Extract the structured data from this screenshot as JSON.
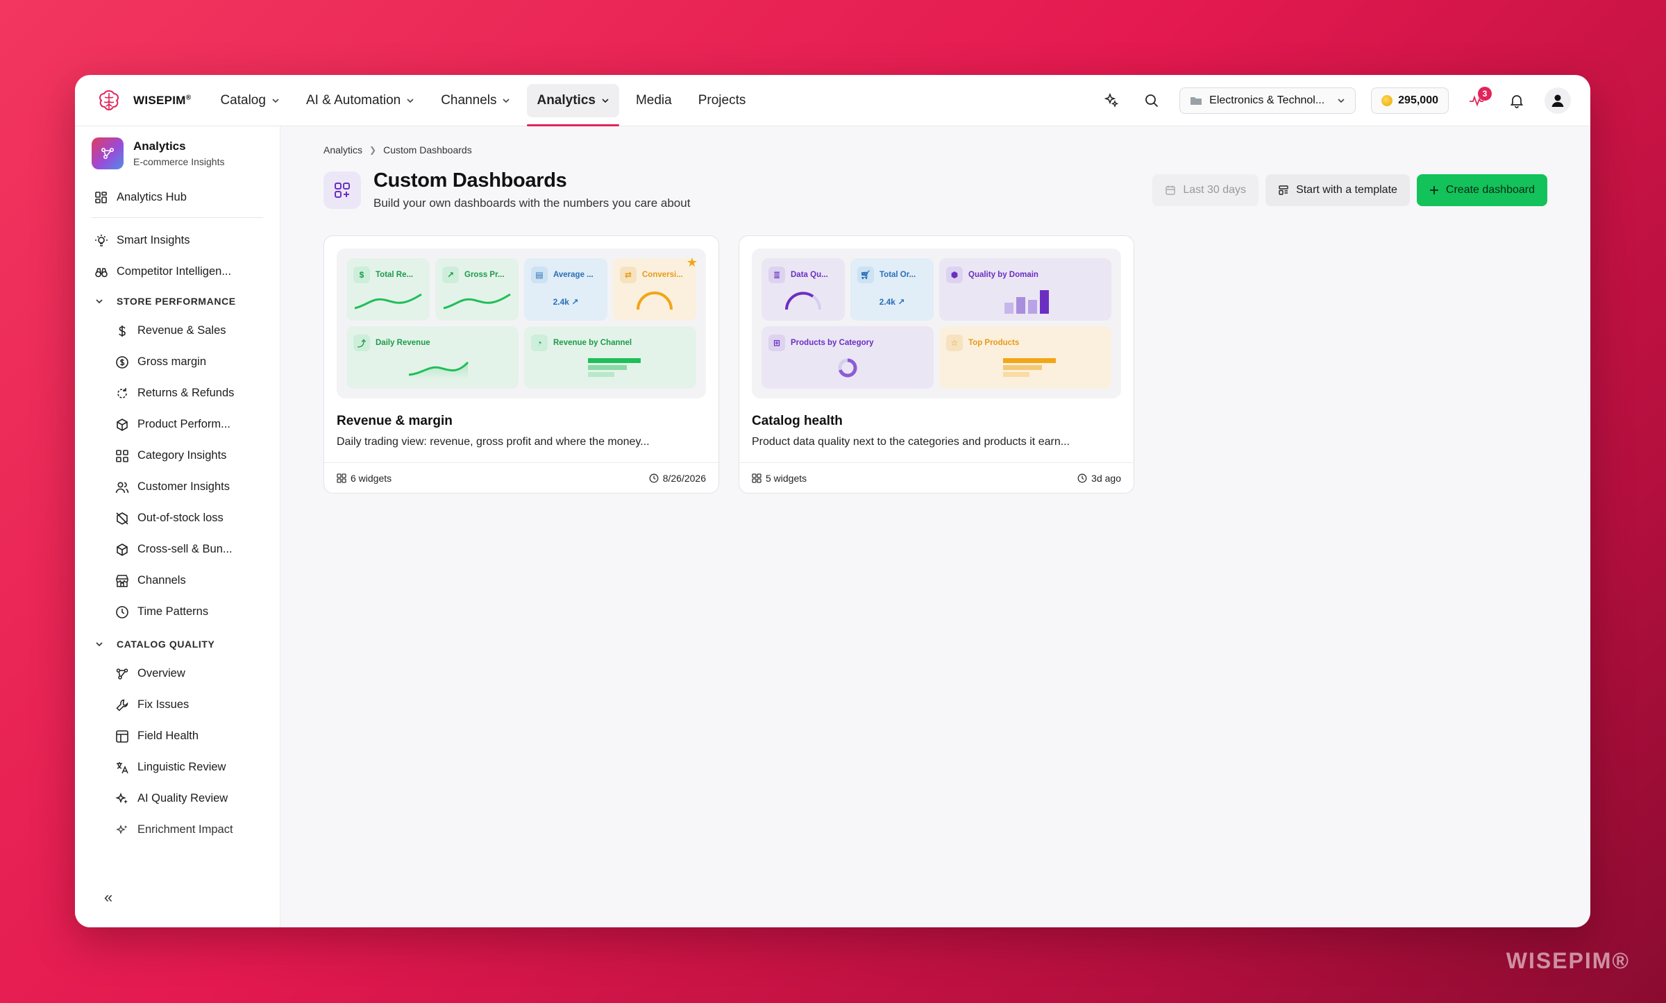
{
  "brand": {
    "name": "WISEPIM",
    "mark": "®"
  },
  "nav": {
    "items": [
      {
        "label": "Catalog",
        "dropdown": true
      },
      {
        "label": "AI & Automation",
        "dropdown": true
      },
      {
        "label": "Channels",
        "dropdown": true
      },
      {
        "label": "Analytics",
        "dropdown": true,
        "active": true
      },
      {
        "label": "Media",
        "dropdown": false
      },
      {
        "label": "Projects",
        "dropdown": false
      }
    ],
    "workspace": "Electronics & Technol...",
    "credits": "295,000",
    "activity_badge": "3"
  },
  "sidebar": {
    "title": "Analytics",
    "subtitle": "E-commerce Insights",
    "hub": "Analytics Hub",
    "top_items": [
      "Smart Insights",
      "Competitor Intelligen..."
    ],
    "sections": [
      {
        "label": "STORE PERFORMANCE",
        "items": [
          "Revenue & Sales",
          "Gross margin",
          "Returns & Refunds",
          "Product Perform...",
          "Category Insights",
          "Customer Insights",
          "Out-of-stock loss",
          "Cross-sell & Bun...",
          "Channels",
          "Time Patterns"
        ]
      },
      {
        "label": "CATALOG QUALITY",
        "items": [
          "Overview",
          "Fix Issues",
          "Field Health",
          "Linguistic Review",
          "AI Quality Review",
          "Enrichment Impact"
        ]
      }
    ],
    "collapse": "«"
  },
  "breadcrumb": [
    "Analytics",
    "Custom Dashboards"
  ],
  "page": {
    "title": "Custom Dashboards",
    "subtitle": "Build your own dashboards with the numbers you care about",
    "actions": {
      "date": "Last 30 days",
      "template": "Start with a template",
      "create": "Create dashboard"
    }
  },
  "cards": [
    {
      "title": "Revenue & margin",
      "description": "Daily trading view: revenue, gross profit and where the money...",
      "widgets": "6 widgets",
      "updated": "8/26/2026",
      "starred": true,
      "tiles": [
        "Total Re...",
        "Gross Pr...",
        "Average ...",
        "Conversi...",
        "Daily Revenue",
        "Revenue by Channel"
      ],
      "kpi": "2.4k"
    },
    {
      "title": "Catalog health",
      "description": "Product data quality next to the categories and products it earn...",
      "widgets": "5 widgets",
      "updated": "3d ago",
      "starred": false,
      "tiles": [
        "Data Qu...",
        "Total Or...",
        "Quality by Domain",
        "Products by Category",
        "Top Products"
      ],
      "kpi": "2.4k"
    }
  ],
  "watermark": "WISEPIM®",
  "colors": {
    "accent": "#e2245a",
    "primary_green": "#13c25a"
  }
}
